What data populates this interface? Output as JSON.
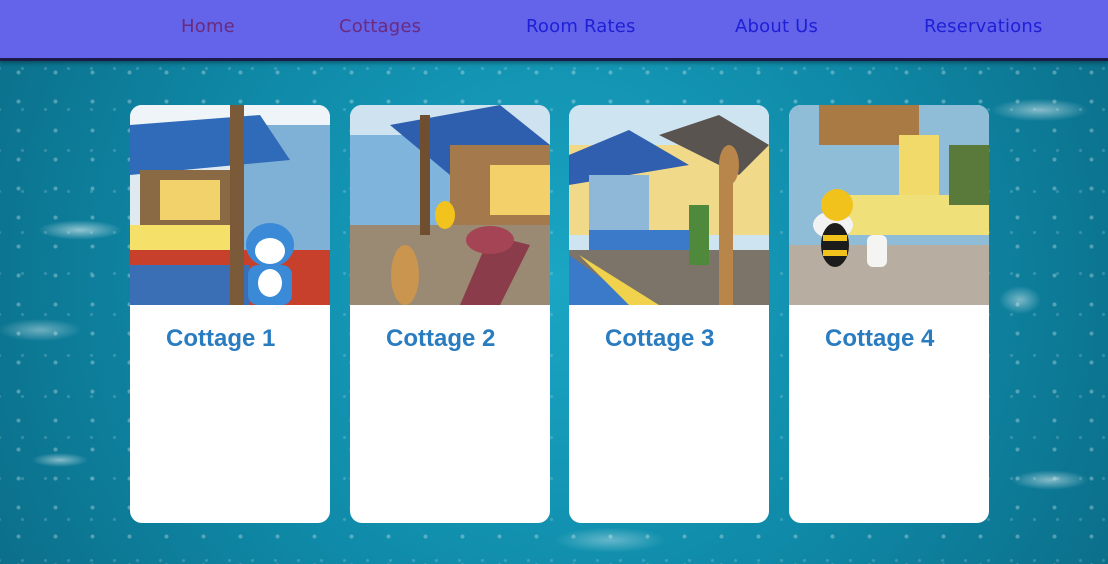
{
  "nav": {
    "items": [
      {
        "label": "Home",
        "state": "visited"
      },
      {
        "label": "Cottages",
        "state": "visited"
      },
      {
        "label": "Room Rates",
        "state": "link"
      },
      {
        "label": "About Us",
        "state": "link"
      },
      {
        "label": "Reservations",
        "state": "link"
      }
    ],
    "colors": {
      "bar": "#6464ea",
      "link": "#1f1fd6",
      "visited": "#6a2a7e"
    }
  },
  "cottages": [
    {
      "title": "Cottage 1"
    },
    {
      "title": "Cottage 2"
    },
    {
      "title": "Cottage 3"
    },
    {
      "title": "Cottage 4"
    }
  ],
  "theme": {
    "title_color": "#2a7cc0",
    "background": "water-splash"
  }
}
